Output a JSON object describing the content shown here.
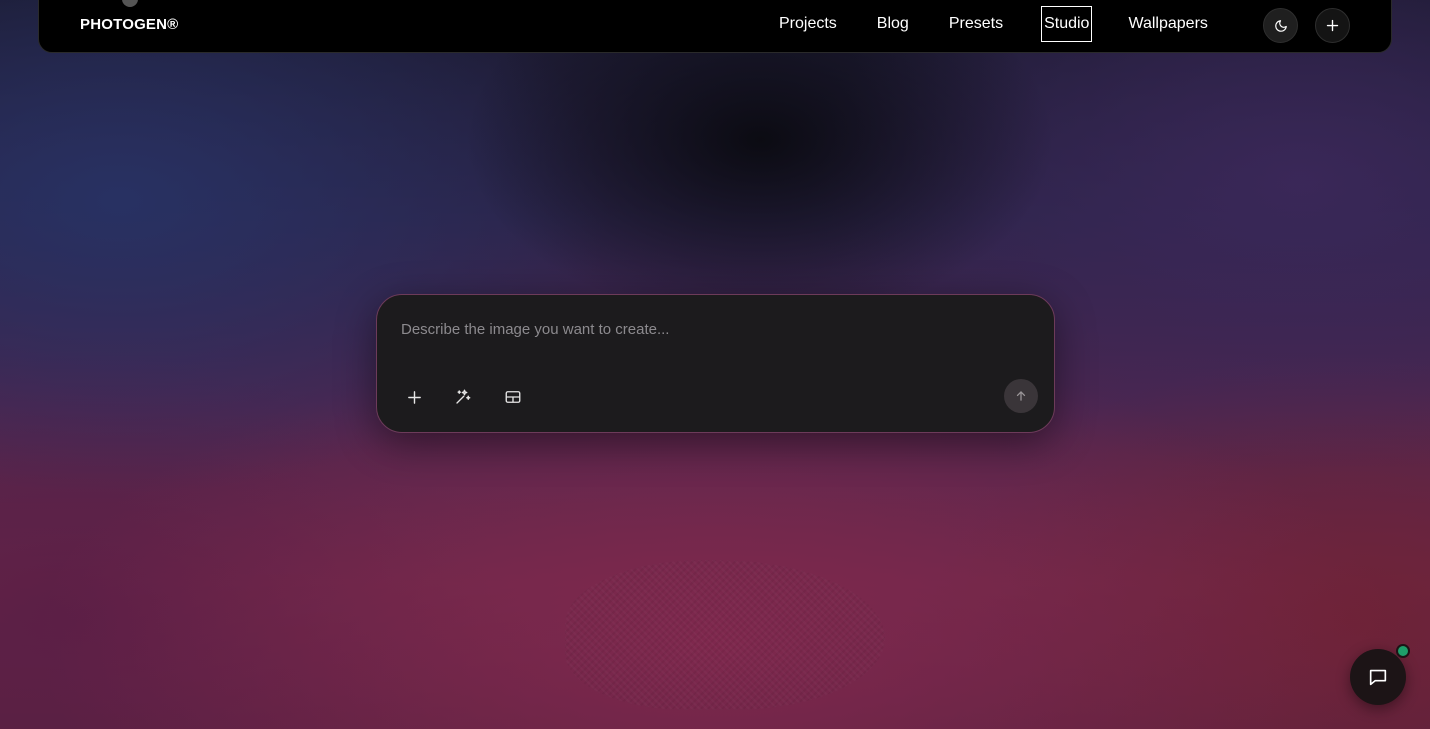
{
  "header": {
    "logo": "PHOTOGEN®",
    "nav": [
      {
        "label": "Projects",
        "active": false
      },
      {
        "label": "Blog",
        "active": false
      },
      {
        "label": "Presets",
        "active": false
      },
      {
        "label": "Studio",
        "active": true
      },
      {
        "label": "Wallpapers",
        "active": false
      }
    ],
    "icons": {
      "theme": "moon-icon",
      "add": "plus-icon"
    }
  },
  "prompt": {
    "placeholder": "Describe the image you want to create...",
    "value": "",
    "tools": [
      "plus-icon",
      "sparkles-icon",
      "grid-icon"
    ],
    "send_icon": "arrow-up-icon"
  },
  "chat": {
    "icon": "chat-bubble-icon",
    "status_color": "#1e9e6a"
  },
  "colors": {
    "accent_border": "#6d3b5a",
    "header_bg": "#000000"
  }
}
